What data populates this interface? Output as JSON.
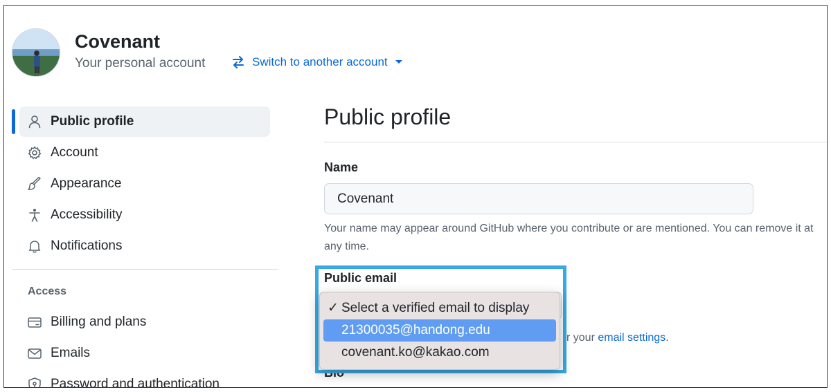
{
  "account": {
    "name": "Covenant",
    "subtitle": "Your personal account",
    "switch_label": "Switch to another account"
  },
  "sidebar": {
    "items": [
      {
        "label": "Public profile",
        "icon": "person-icon",
        "active": true
      },
      {
        "label": "Account",
        "icon": "gear-icon"
      },
      {
        "label": "Appearance",
        "icon": "paintbrush-icon"
      },
      {
        "label": "Accessibility",
        "icon": "accessibility-icon"
      },
      {
        "label": "Notifications",
        "icon": "bell-icon"
      }
    ],
    "access_heading": "Access",
    "access_items": [
      {
        "label": "Billing and plans",
        "icon": "credit-card-icon"
      },
      {
        "label": "Emails",
        "icon": "mail-icon"
      },
      {
        "label": "Password and authentication",
        "icon": "shield-lock-icon"
      }
    ]
  },
  "main": {
    "title": "Public profile",
    "name_label": "Name",
    "name_value": "Covenant",
    "name_help": "Your name may appear around GitHub where you contribute or are mentioned. You can remove it at any time.",
    "email_label": "Public email",
    "email_help_prefix": "r your",
    "email_help_link": "email settings",
    "email_help_suffix": ".",
    "bio_label": "Bio"
  },
  "email_dropdown": {
    "options": [
      {
        "label": "Select a verified email to display",
        "checked": true
      },
      {
        "label": "21300035@handong.edu",
        "highlighted": true
      },
      {
        "label": "covenant.ko@kakao.com"
      }
    ]
  },
  "colors": {
    "accent": "#0969da",
    "highlight_border": "#3aa8e4",
    "selected_option": "#5f9cf2"
  }
}
